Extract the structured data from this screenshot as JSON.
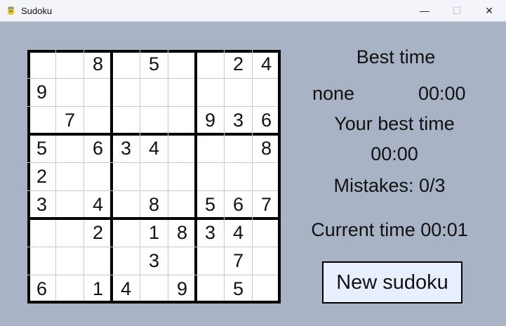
{
  "window": {
    "title": "Sudoku",
    "minimize_glyph": "—",
    "maximize_glyph": "☐",
    "close_glyph": "✕",
    "icon": "python-snake-icon"
  },
  "board": {
    "rows": [
      [
        "",
        "",
        "8",
        "",
        "5",
        "",
        "",
        "2",
        "4"
      ],
      [
        "9",
        "",
        "",
        "",
        "",
        "",
        "",
        "",
        ""
      ],
      [
        "",
        "7",
        "",
        "",
        "",
        "",
        "9",
        "3",
        "6"
      ],
      [
        "5",
        "",
        "6",
        "3",
        "4",
        "",
        "",
        "",
        "8"
      ],
      [
        "2",
        "",
        "",
        "",
        "",
        "",
        "",
        "",
        ""
      ],
      [
        "3",
        "",
        "4",
        "",
        "8",
        "",
        "5",
        "6",
        "7"
      ],
      [
        "",
        "",
        "2",
        "",
        "1",
        "8",
        "3",
        "4",
        ""
      ],
      [
        "",
        "",
        "",
        "",
        "3",
        "",
        "",
        "7",
        ""
      ],
      [
        "6",
        "",
        "1",
        "4",
        "",
        "9",
        "",
        "5",
        ""
      ]
    ]
  },
  "panel": {
    "best_time_heading": "Best time",
    "best_name": "none",
    "best_value": "00:00",
    "your_best_heading": "Your best time",
    "your_best_value": "00:00",
    "mistakes": "Mistakes: 0/3",
    "current_time": "Current time 00:01",
    "new_button": "New sudoku"
  },
  "colors": {
    "background": "#a9b3c6",
    "board": "#ffffff",
    "button": "#e8efff"
  }
}
